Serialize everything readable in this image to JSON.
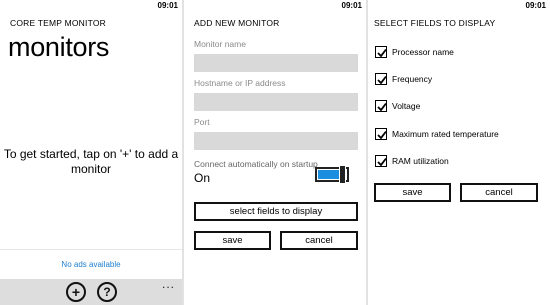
{
  "clock": "09:01",
  "screen_main": {
    "app_title": "CORE TEMP MONITOR",
    "page_title": "monitors",
    "empty_hint": "To get started, tap on '+' to add a monitor",
    "ad_text": "No ads available",
    "appbar": {
      "add_icon": "+",
      "help_icon": "?",
      "more": "..."
    }
  },
  "screen_add": {
    "title": "ADD NEW MONITOR",
    "fields": [
      {
        "label": "Monitor name",
        "value": ""
      },
      {
        "label": "Hostname or IP address",
        "value": ""
      },
      {
        "label": "Port",
        "value": ""
      }
    ],
    "toggle_label": "Connect automatically on startup",
    "toggle_state": "On",
    "toggle_on": true,
    "select_button": "select fields to display",
    "save_button": "save",
    "cancel_button": "cancel"
  },
  "screen_fields": {
    "title": "SELECT FIELDS TO DISPLAY",
    "items": [
      {
        "label": "Processor name",
        "checked": true
      },
      {
        "label": "Frequency",
        "checked": true
      },
      {
        "label": "Voltage",
        "checked": true
      },
      {
        "label": "Maximum rated temperature",
        "checked": true
      },
      {
        "label": "RAM utilization",
        "checked": true
      }
    ],
    "save_button": "save",
    "cancel_button": "cancel"
  },
  "colors": {
    "accent": "#1c8ee0",
    "link": "#1e7fd0",
    "input_bg": "#d9d9d9",
    "appbar_bg": "#dddddd"
  }
}
